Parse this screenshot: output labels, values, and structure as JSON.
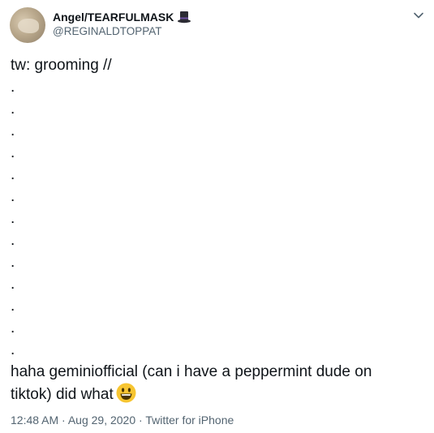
{
  "author": {
    "display_name": "Angel/TEARFULMASK",
    "handle": "@REGINALDTOPPAT",
    "name_emoji": "top-hat-icon",
    "avatar": "avatar-photo"
  },
  "tweet": {
    "first_line": "tw: grooming //",
    "dots": [
      ".",
      ".",
      ".",
      ".",
      ".",
      ".",
      ".",
      ".",
      ".",
      ".",
      ".",
      ".",
      "."
    ],
    "body_line_1": "haha geminiofficial (can i have a peppermint dude on",
    "body_line_2": "tiktok) did what",
    "trailing_emoji": "smiling-face-icon"
  },
  "meta": {
    "time": "12:48 AM",
    "separator_1": " · ",
    "date": "Aug 29, 2020",
    "separator_2": " · ",
    "source": "Twitter for iPhone"
  },
  "colors": {
    "text": "#0f1419",
    "secondary": "#536471",
    "background": "#ffffff"
  }
}
